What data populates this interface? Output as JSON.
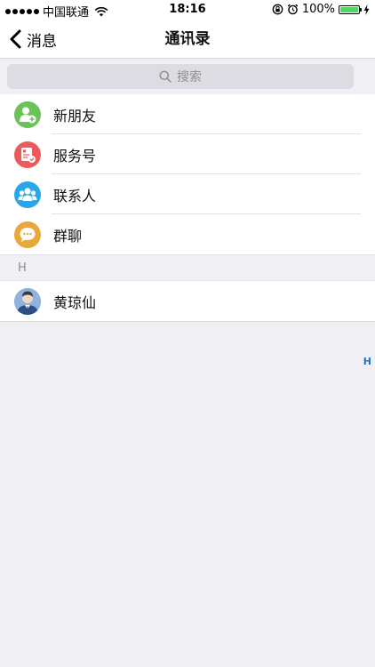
{
  "status_bar": {
    "carrier": "中国联通",
    "time": "18:16",
    "battery_percent": "100%",
    "battery_level": 1.0,
    "battery_color": "#4cd964"
  },
  "nav": {
    "back_label": "消息",
    "title": "通讯录"
  },
  "search": {
    "placeholder": "搜索"
  },
  "menu_items": [
    {
      "label": "新朋友",
      "icon": "add-friend-icon",
      "color": "#6ac259"
    },
    {
      "label": "服务号",
      "icon": "service-account-icon",
      "color": "#ee5a5a"
    },
    {
      "label": "联系人",
      "icon": "contacts-icon",
      "color": "#2aa7ea"
    },
    {
      "label": "群聊",
      "icon": "group-chat-icon",
      "color": "#e8a83a"
    }
  ],
  "sections": [
    {
      "header": "H",
      "contacts": [
        {
          "name": "黄琼仙",
          "icon": "user-avatar-icon"
        }
      ]
    }
  ],
  "index_bar": [
    "H"
  ]
}
